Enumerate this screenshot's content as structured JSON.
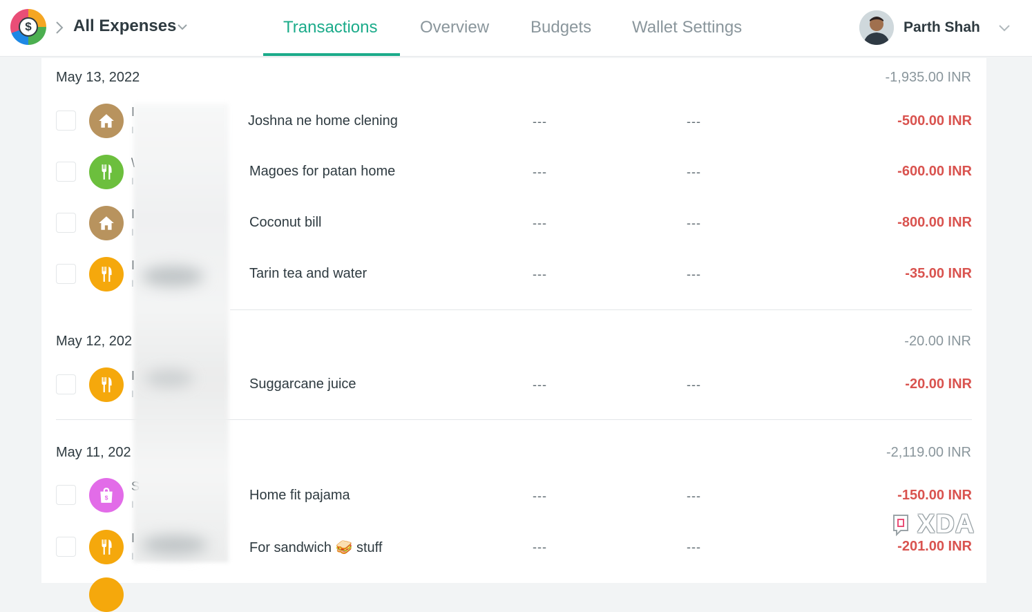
{
  "header": {
    "wallet_title": "All Expenses",
    "tabs": [
      {
        "label": "Transactions",
        "active": true
      },
      {
        "label": "Overview",
        "active": false
      },
      {
        "label": "Budgets",
        "active": false
      },
      {
        "label": "Wallet Settings",
        "active": false
      }
    ],
    "user_name": "Parth Shah",
    "logo_symbol": "$"
  },
  "groups": [
    {
      "date": "May 13, 2022",
      "total": "-1,935.00 INR",
      "rows": [
        {
          "category_icon": "home-icon",
          "icon_color": "#b8935e",
          "name_initial": "I",
          "sub_initial": "I",
          "note": "Joshna ne home clening",
          "col3": "---",
          "col4": "---",
          "amount": "-500.00 INR"
        },
        {
          "category_icon": "food-icon",
          "icon_color": "#6cbf3d",
          "name_initial": "\\",
          "sub_initial": "I",
          "note": "Magoes for patan home",
          "col3": "---",
          "col4": "---",
          "amount": "-600.00 INR"
        },
        {
          "category_icon": "home-icon",
          "icon_color": "#b8935e",
          "name_initial": "I",
          "sub_initial": "I",
          "note": "Coconut bill",
          "col3": "---",
          "col4": "---",
          "amount": "-800.00 INR"
        },
        {
          "category_icon": "food-icon",
          "icon_color": "#f5a80c",
          "name_initial": "I",
          "sub_initial": "I",
          "note": "Tarin tea and water",
          "col3": "---",
          "col4": "---",
          "amount": "-35.00 INR"
        }
      ]
    },
    {
      "date": "May 12, 202",
      "total": "-20.00 INR",
      "rows": [
        {
          "category_icon": "food-icon",
          "icon_color": "#f5a80c",
          "name_initial": "I",
          "sub_initial": "I",
          "note": "Suggarcane juice",
          "col3": "---",
          "col4": "---",
          "amount": "-20.00 INR"
        }
      ]
    },
    {
      "date": "May 11, 202",
      "total": "-2,119.00 INR",
      "rows": [
        {
          "category_icon": "shopping-bag-icon",
          "icon_color": "#e26ce8",
          "name_initial": "S",
          "sub_initial": "I",
          "note": "Home fit pajama",
          "col3": "---",
          "col4": "---",
          "amount": "-150.00 INR"
        },
        {
          "category_icon": "food-icon",
          "icon_color": "#f5a80c",
          "name_initial": "I",
          "sub_initial": "I",
          "note": "For sandwich 🥪 stuff",
          "col3": "---",
          "col4": "---",
          "amount": "-201.00 INR"
        }
      ]
    }
  ],
  "watermark": "XDA",
  "colors": {
    "accent": "#1bab8a",
    "negative_amount": "#d9534f",
    "muted_text": "#8a969c"
  }
}
